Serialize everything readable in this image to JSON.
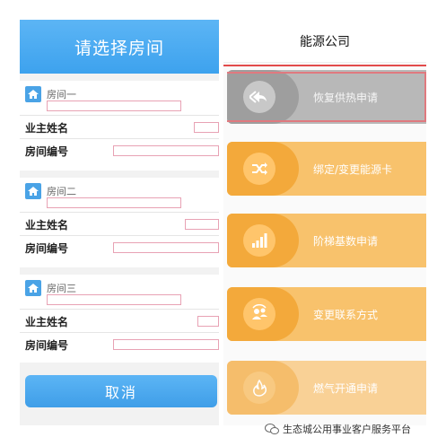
{
  "left": {
    "header_title": "请选择房间",
    "rooms": [
      {
        "title": "房间一",
        "owner_label": "业主姓名",
        "number_label": "房间编号"
      },
      {
        "title": "房间二",
        "owner_label": "业主姓名",
        "number_label": "房间编号"
      },
      {
        "title": "房间三",
        "owner_label": "业主姓名",
        "number_label": "房间编号"
      }
    ],
    "cancel_label": "取消"
  },
  "right": {
    "header_title": "能源公司",
    "menu": [
      {
        "label": "恢复供热申请",
        "icon": "back-arrows-icon"
      },
      {
        "label": "绑定/变更能源卡",
        "icon": "shuffle-icon"
      },
      {
        "label": "阶梯基数申请",
        "icon": "bar-chart-icon"
      },
      {
        "label": "变更联系方式",
        "icon": "contacts-icon"
      },
      {
        "label": "燃气开通申请",
        "icon": "flame-icon"
      }
    ]
  },
  "watermark": "生态城公用事业客户服务平台",
  "colors": {
    "blue": "#3da2ee",
    "orange": "#f3a93b",
    "grey": "#9e9e9e",
    "input_border": "#e8a2b4"
  }
}
